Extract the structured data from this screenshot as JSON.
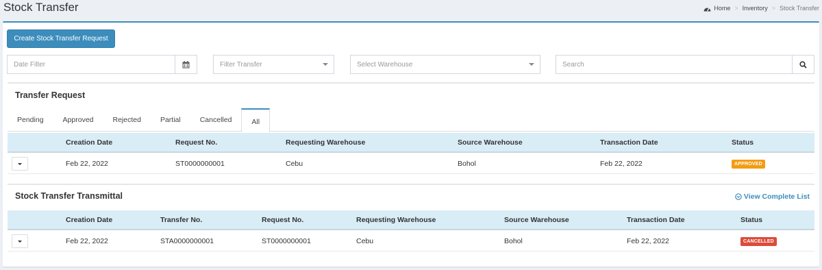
{
  "header": {
    "title": "Stock Transfer",
    "breadcrumb": [
      "Home",
      "Inventory",
      "Stock Transfer"
    ]
  },
  "toolbar": {
    "create_label": "Create Stock Transfer Request"
  },
  "filters": {
    "date_placeholder": "Date Filter",
    "transfer_placeholder": "Filter Transfer",
    "warehouse_placeholder": "Select Warehouse",
    "search_placeholder": "Search"
  },
  "request": {
    "title": "Transfer Request",
    "tabs": [
      "Pending",
      "Approved",
      "Rejected",
      "Partial",
      "Cancelled",
      "All"
    ],
    "active_tab": "All",
    "columns": [
      "Creation Date",
      "Request No.",
      "Requesting Warehouse",
      "Source Warehouse",
      "Transaction Date",
      "Status"
    ],
    "rows": [
      {
        "creation_date": "Feb 22, 2022",
        "request_no": "ST0000000001",
        "requesting_warehouse": "Cebu",
        "source_warehouse": "Bohol",
        "transaction_date": "Feb 22, 2022",
        "status": "APPROVED"
      }
    ]
  },
  "transmittal": {
    "title": "Stock Transfer Transmittal",
    "view_link": "View Complete List",
    "columns": [
      "Creation Date",
      "Transfer No.",
      "Request No.",
      "Requesting Warehouse",
      "Source Warehouse",
      "Transaction Date",
      "Status"
    ],
    "rows": [
      {
        "creation_date": "Feb 22, 2022",
        "transfer_no": "STA0000000001",
        "request_no": "ST0000000001",
        "requesting_warehouse": "Cebu",
        "source_warehouse": "Bohol",
        "transaction_date": "Feb 22, 2022",
        "status": "CANCELLED"
      }
    ]
  },
  "colors": {
    "primary": "#3c8dbc",
    "approved": "#f39c12",
    "cancelled": "#dd4b39",
    "table_header": "#d9edf7"
  },
  "icons": {
    "breadcrumb_home": "dashboard-icon",
    "date_addon": "calendar-icon",
    "search_addon": "search-icon",
    "view_link": "arrow-circle-down-icon"
  }
}
